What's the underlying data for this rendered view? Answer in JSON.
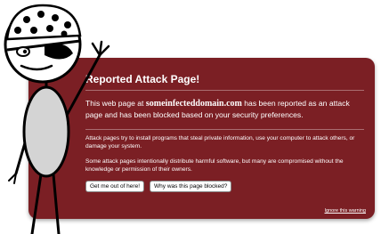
{
  "warning": {
    "title": "Reported Attack Page!",
    "headline_prefix": "This web page at ",
    "domain": "someinfecteddomain.com",
    "headline_suffix": " has been reported as an attack page and has been blocked based on your security preferences.",
    "para1": "Attack pages try to install programs that steal private information, use your computer to attack others, or damage your system.",
    "para2": "Some attack pages intentionally distribute harmful software, but many are compromised without the knowledge or permission of their owners.",
    "get_me_out_label": "Get me out of here!",
    "why_blocked_label": "Why was this page blocked?",
    "ignore_label": "Ignore this warning"
  },
  "colors": {
    "panel": "#7b1f24",
    "text": "#ffffff"
  },
  "icons": {
    "illustration": "pirate-stick-figure"
  }
}
